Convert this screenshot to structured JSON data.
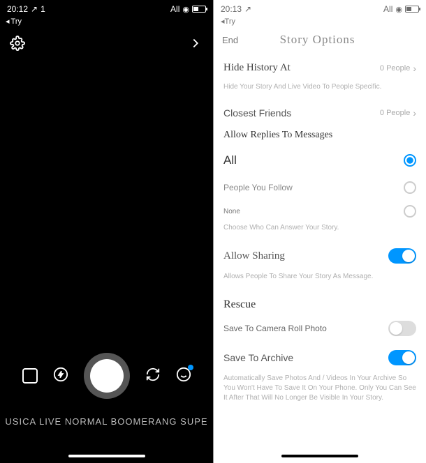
{
  "left": {
    "status": {
      "time": "20:12",
      "signal_suffix": "1",
      "right_label": "All"
    },
    "back": "Try",
    "modes": "USICA LIVE NORMAL BOOMERANG SUPE"
  },
  "right": {
    "status": {
      "time": "20:13",
      "right_label": "All"
    },
    "back": "Try",
    "header": {
      "end": "End",
      "title": "Story Options"
    },
    "hide_history": {
      "label": "Hide History At",
      "value": "0 People",
      "desc": "Hide Your Story And Live Video To People Specific."
    },
    "closest_friends": {
      "label": "Closest Friends",
      "value": "0 People"
    },
    "allow_replies": {
      "title": "Allow Replies To Messages",
      "options": {
        "all": "All",
        "follow": "People You Follow",
        "none": "None"
      },
      "desc": "Choose Who Can Answer Your Story."
    },
    "allow_sharing": {
      "label": "Allow Sharing",
      "desc": "Allows People To Share Your Story As Message."
    },
    "rescue": {
      "title": "Rescue",
      "save_roll": "Save To Camera Roll Photo",
      "save_archive": "Save To Archive",
      "desc": "Automatically Save Photos And / Videos In Your Archive So You Won't Have To Save It On Your Phone. Only You Can See It After That Will No Longer Be Visible In Your Story."
    }
  }
}
